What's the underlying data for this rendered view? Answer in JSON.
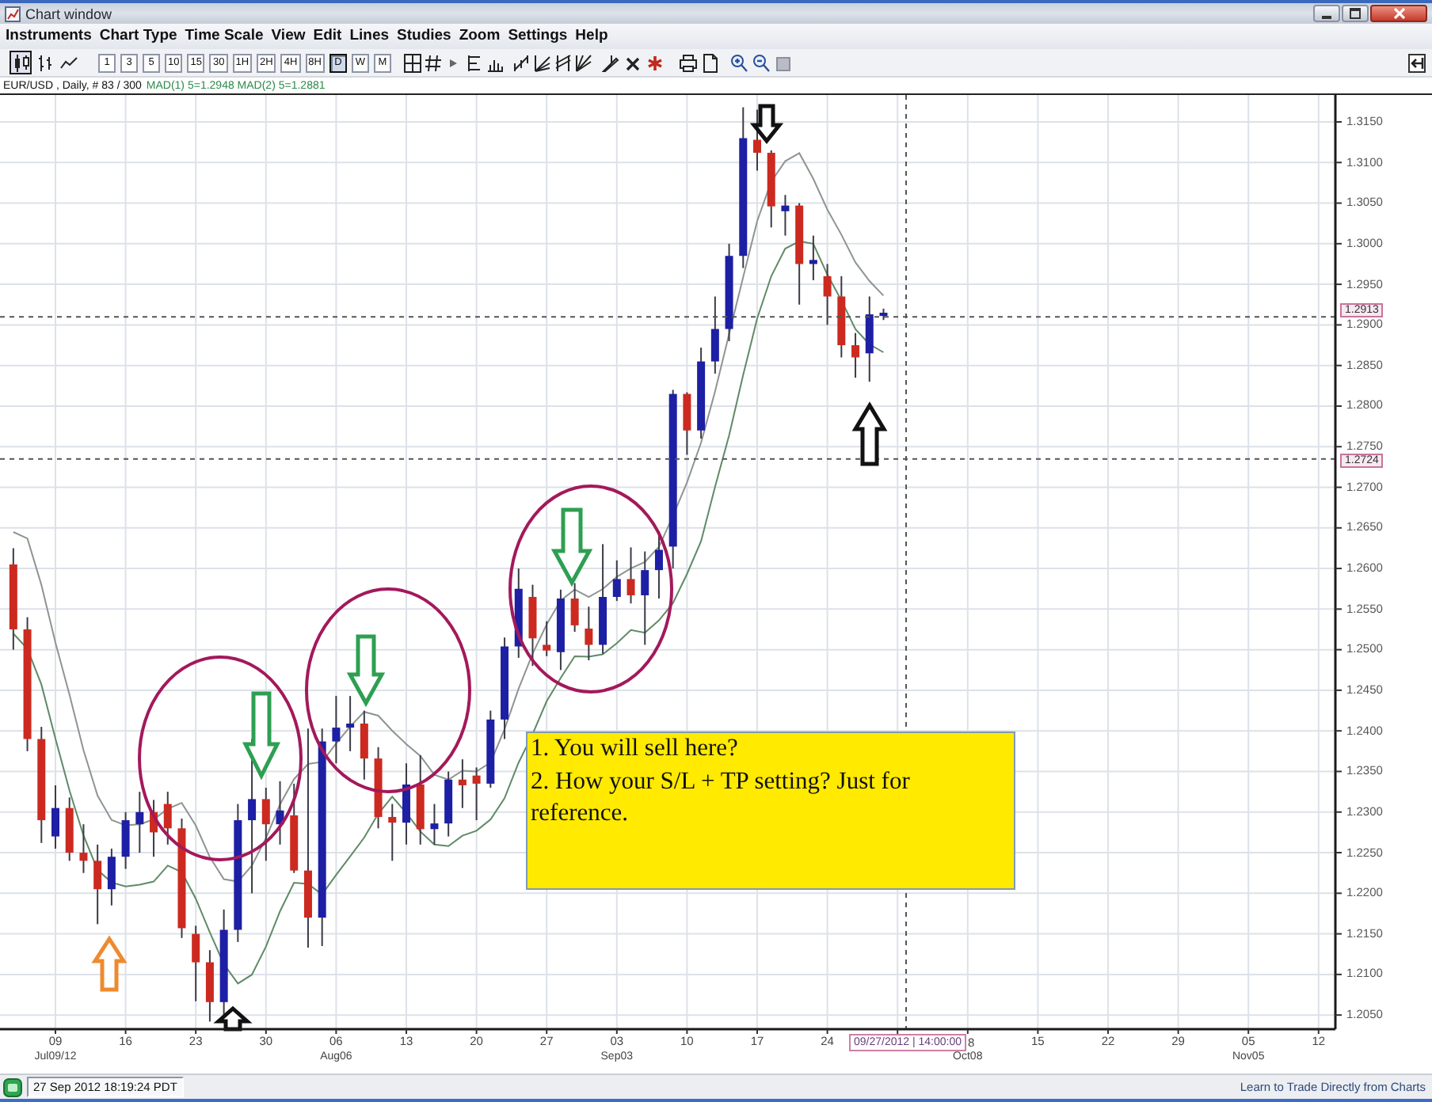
{
  "window": {
    "title": "Chart window"
  },
  "menu": [
    "Instruments",
    "Chart Type",
    "Time Scale",
    "View",
    "Edit",
    "Lines",
    "Studies",
    "Zoom",
    "Settings",
    "Help"
  ],
  "toolbar": {
    "chart_styles": [
      {
        "selected": true
      },
      {
        "selected": false
      },
      {
        "selected": false
      }
    ],
    "periods": [
      {
        "label": "1",
        "selected": false
      },
      {
        "label": "3",
        "selected": false
      },
      {
        "label": "5",
        "selected": false
      },
      {
        "label": "10",
        "selected": false
      },
      {
        "label": "15",
        "selected": false
      },
      {
        "label": "30",
        "selected": false
      },
      {
        "label": "1H",
        "selected": false
      },
      {
        "label": "2H",
        "selected": false
      },
      {
        "label": "4H",
        "selected": false
      },
      {
        "label": "8H",
        "selected": false
      },
      {
        "label": "D",
        "selected": true
      },
      {
        "label": "W",
        "selected": false
      },
      {
        "label": "M",
        "selected": false
      }
    ]
  },
  "legend": {
    "symbol": "EUR/USD , Daily, # 83 / 300",
    "studies": "MAD(1) 5=1.2948 MAD(2) 5=1.2881"
  },
  "chart": {
    "price_labels": [
      "1.3150",
      "1.3100",
      "1.3050",
      "1.3000",
      "1.2950",
      "1.2900",
      "1.2850",
      "1.2800",
      "1.2750",
      "1.2700",
      "1.2650",
      "1.2600",
      "1.2550",
      "1.2500",
      "1.2450",
      "1.2400",
      "1.2350",
      "1.2300",
      "1.2250",
      "1.2200",
      "1.2150",
      "1.2100",
      "1.2050"
    ],
    "price_markers": [
      "1.2913",
      "1.2724"
    ],
    "date_ticks": [
      {
        "day": "09",
        "month": "Jul09/12"
      },
      {
        "day": "16"
      },
      {
        "day": "23"
      },
      {
        "day": "30"
      },
      {
        "day": "06",
        "month": "Aug06"
      },
      {
        "day": "13"
      },
      {
        "day": "20"
      },
      {
        "day": "27"
      },
      {
        "day": "03",
        "month": "Sep03"
      },
      {
        "day": "10"
      },
      {
        "day": "17"
      },
      {
        "day": "24"
      }
    ],
    "cursor_label": "09/27/2012 | 14:00:00",
    "date_ticks_after": [
      {
        "day": "8",
        "month": "Oct08"
      },
      {
        "day": "15"
      },
      {
        "day": "22"
      },
      {
        "day": "29"
      },
      {
        "day": "05",
        "month": "Nov05"
      },
      {
        "day": "12"
      }
    ],
    "note": [
      "1. You will sell here?",
      "2. How your S/L + TP setting? Just for reference."
    ]
  },
  "status_bar": {
    "time": "27 Sep 2012 18:19:24 PDT",
    "link": "Learn to Trade Directly from Charts"
  }
}
